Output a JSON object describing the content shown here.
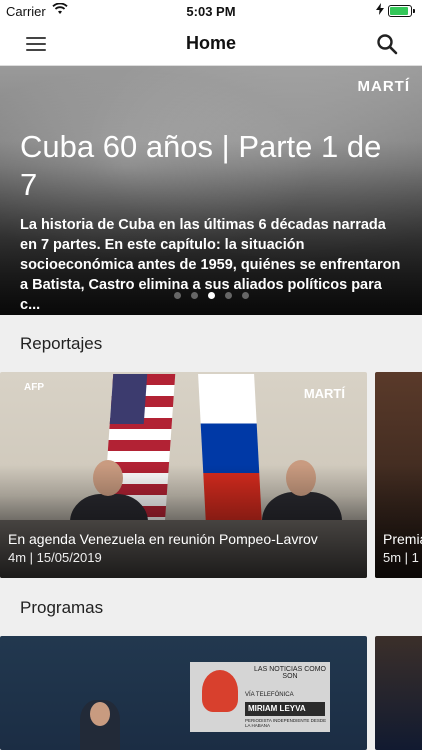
{
  "status_bar": {
    "carrier": "Carrier",
    "time": "5:03 PM"
  },
  "nav": {
    "title": "Home"
  },
  "hero": {
    "logo": "MARTÍ",
    "logo_sub": "",
    "title": "Cuba 60 años | Parte 1 de 7",
    "description": "La historia de Cuba en las últimas 6 décadas narrada en 7 partes. En este capítulo: la situación socioeconómica antes de 1959, quiénes se enfrentaron a Batista, Castro elimina a sus aliados políticos para c...",
    "page_count": 5,
    "active_page": 3
  },
  "sections": {
    "reportajes": {
      "label": "Reportajes",
      "cards": [
        {
          "title": "En agenda Venezuela en reunión Pompeo-Lavrov",
          "meta": "4m | 15/05/2019",
          "badge_left": "AFP",
          "badge_right": "MARTÍ"
        },
        {
          "title": "Premia",
          "meta": "5m | 1"
        }
      ]
    },
    "programas": {
      "label": "Programas",
      "cards": [
        {
          "overlay_header": "LAS NOTICIAS COMO SON",
          "overlay_call": "VÍA TELEFÓNICA",
          "overlay_name": "MIRIAM LEYVA",
          "overlay_role": "PERIODISTA INDEPENDIENTE DESDE LA HABANA"
        },
        {}
      ]
    }
  },
  "colors": {
    "accent_battery": "#34c759",
    "background": "#efefef"
  }
}
